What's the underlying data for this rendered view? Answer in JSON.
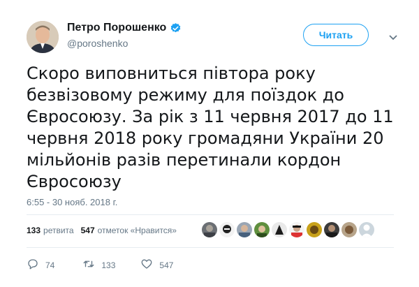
{
  "author": {
    "name": "Петро Порошенко",
    "handle": "@poroshenko",
    "verified_icon": "verified-badge-icon"
  },
  "follow_button": {
    "label": "Читать"
  },
  "tweet": {
    "lines": [
      "Скоро виповниться півтора року",
      "безвізовому режиму для поїздок до",
      "Євросоюзу. За рік з 11 червня 2017 до 11",
      "червня 2018 року громадяни України 20",
      "мільйонів разів перетинали кордон",
      "Євросоюзу"
    ],
    "timestamp": "6:55 - 30 нояб. 2018 г."
  },
  "stats": {
    "retweets_count": "133",
    "retweets_label": "ретвита",
    "likes_count": "547",
    "likes_label": "отметок «Нравится»"
  },
  "actions": {
    "reply_count": "74",
    "retweet_count": "133",
    "like_count": "547"
  },
  "colors": {
    "accent": "#1da1f2",
    "muted": "#657786",
    "text": "#14171a"
  }
}
